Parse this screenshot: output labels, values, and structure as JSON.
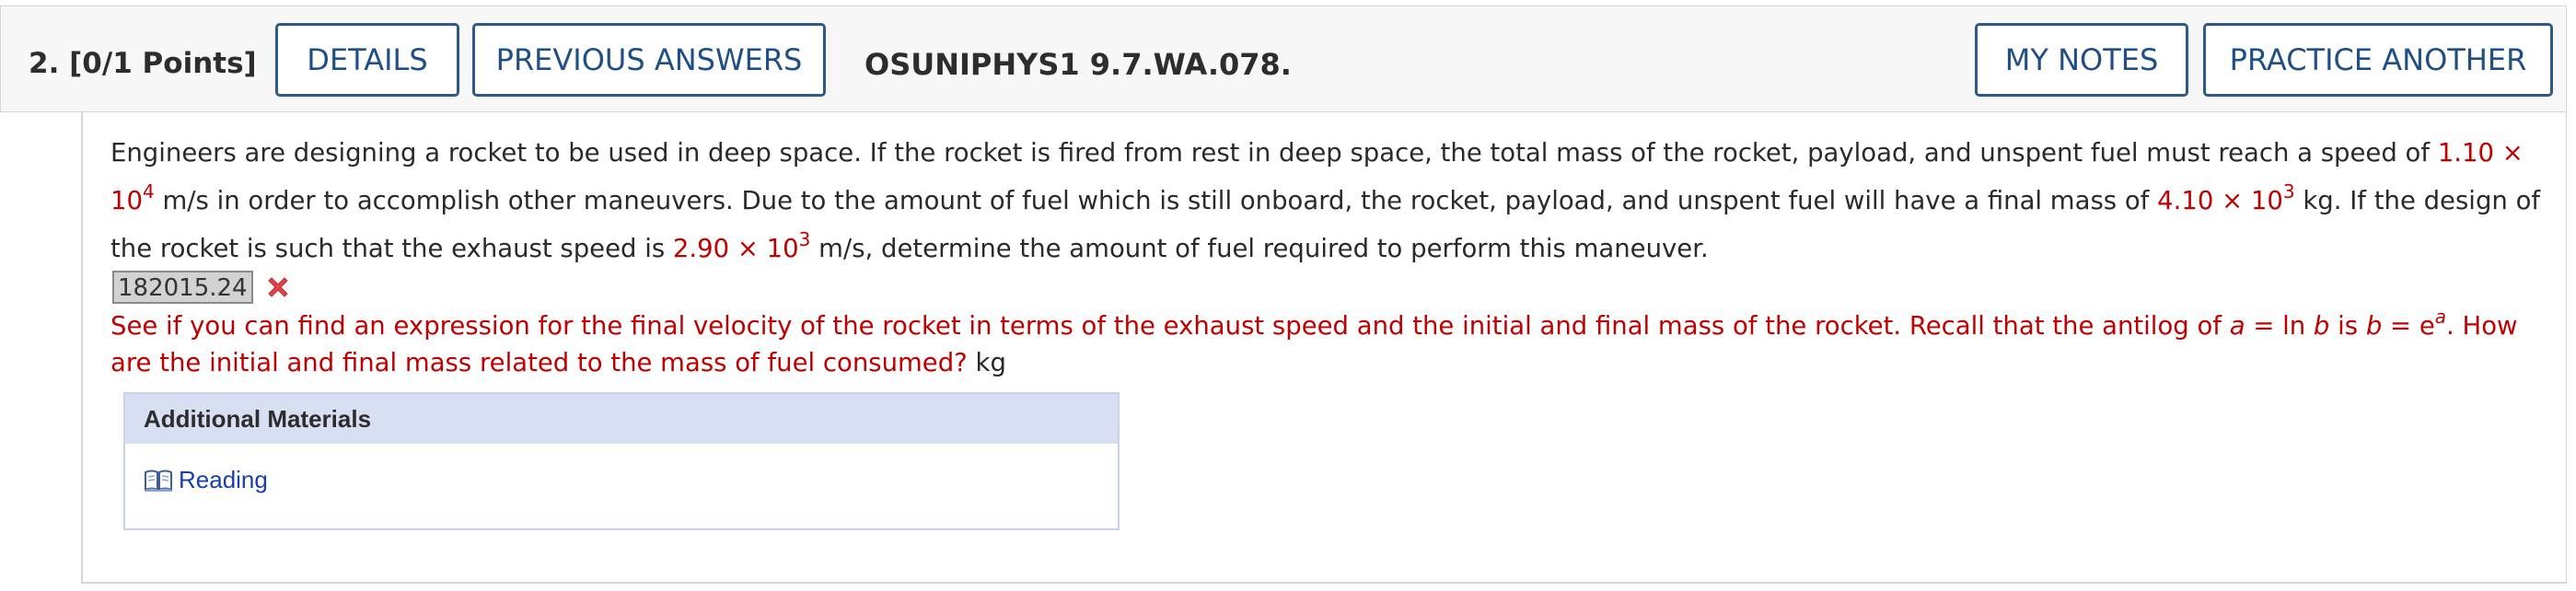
{
  "header": {
    "question_label": "2.  [0/1 Points]",
    "details_label": "DETAILS",
    "previous_answers_label": "PREVIOUS ANSWERS",
    "code": "OSUNIPHYS1 9.7.WA.078.",
    "my_notes_label": "MY NOTES",
    "practice_another_label": "PRACTICE ANOTHER"
  },
  "problem": {
    "t1": "Engineers are designing a rocket to be used in deep space. If the rocket is fired from rest in deep space, the total mass of the rocket, payload, and unspent fuel must reach a speed of ",
    "v1": "1.10 × 10",
    "v1_exp": "4",
    "t2": " m/s in order to accomplish other maneuvers. Due to the amount of fuel which is still onboard, the rocket, payload, and unspent fuel will have a final mass of ",
    "v2": "4.10 × 10",
    "v2_exp": "3",
    "t3": " kg. If the design of the rocket is such that the exhaust speed is ",
    "v3": "2.90 × 10",
    "v3_exp": "3",
    "t4": " m/s, determine the amount of fuel required to perform this maneuver."
  },
  "answer": {
    "value": "182015.24",
    "status_icon": "incorrect-x-icon"
  },
  "hint": {
    "h1": "See if you can find an expression for the final velocity of the rocket in terms of the exhaust speed and the initial and final mass of the rocket. Recall that the antilog of ",
    "a1": "a",
    "h2": " = ln ",
    "b1": "b",
    "h3": " is ",
    "b2": "b",
    "h4": " = e",
    "a_exp": "a",
    "h5": ". How are the initial and final mass related to the mass of fuel consumed?",
    "unit": " kg"
  },
  "materials": {
    "title": "Additional Materials",
    "reading_label": "Reading",
    "reading_icon": "book-icon"
  },
  "colors": {
    "accent_blue": "#1f4f86",
    "error_red": "#c00000",
    "link_blue": "#1a3fa8",
    "materials_header_bg": "#d9dff3"
  }
}
